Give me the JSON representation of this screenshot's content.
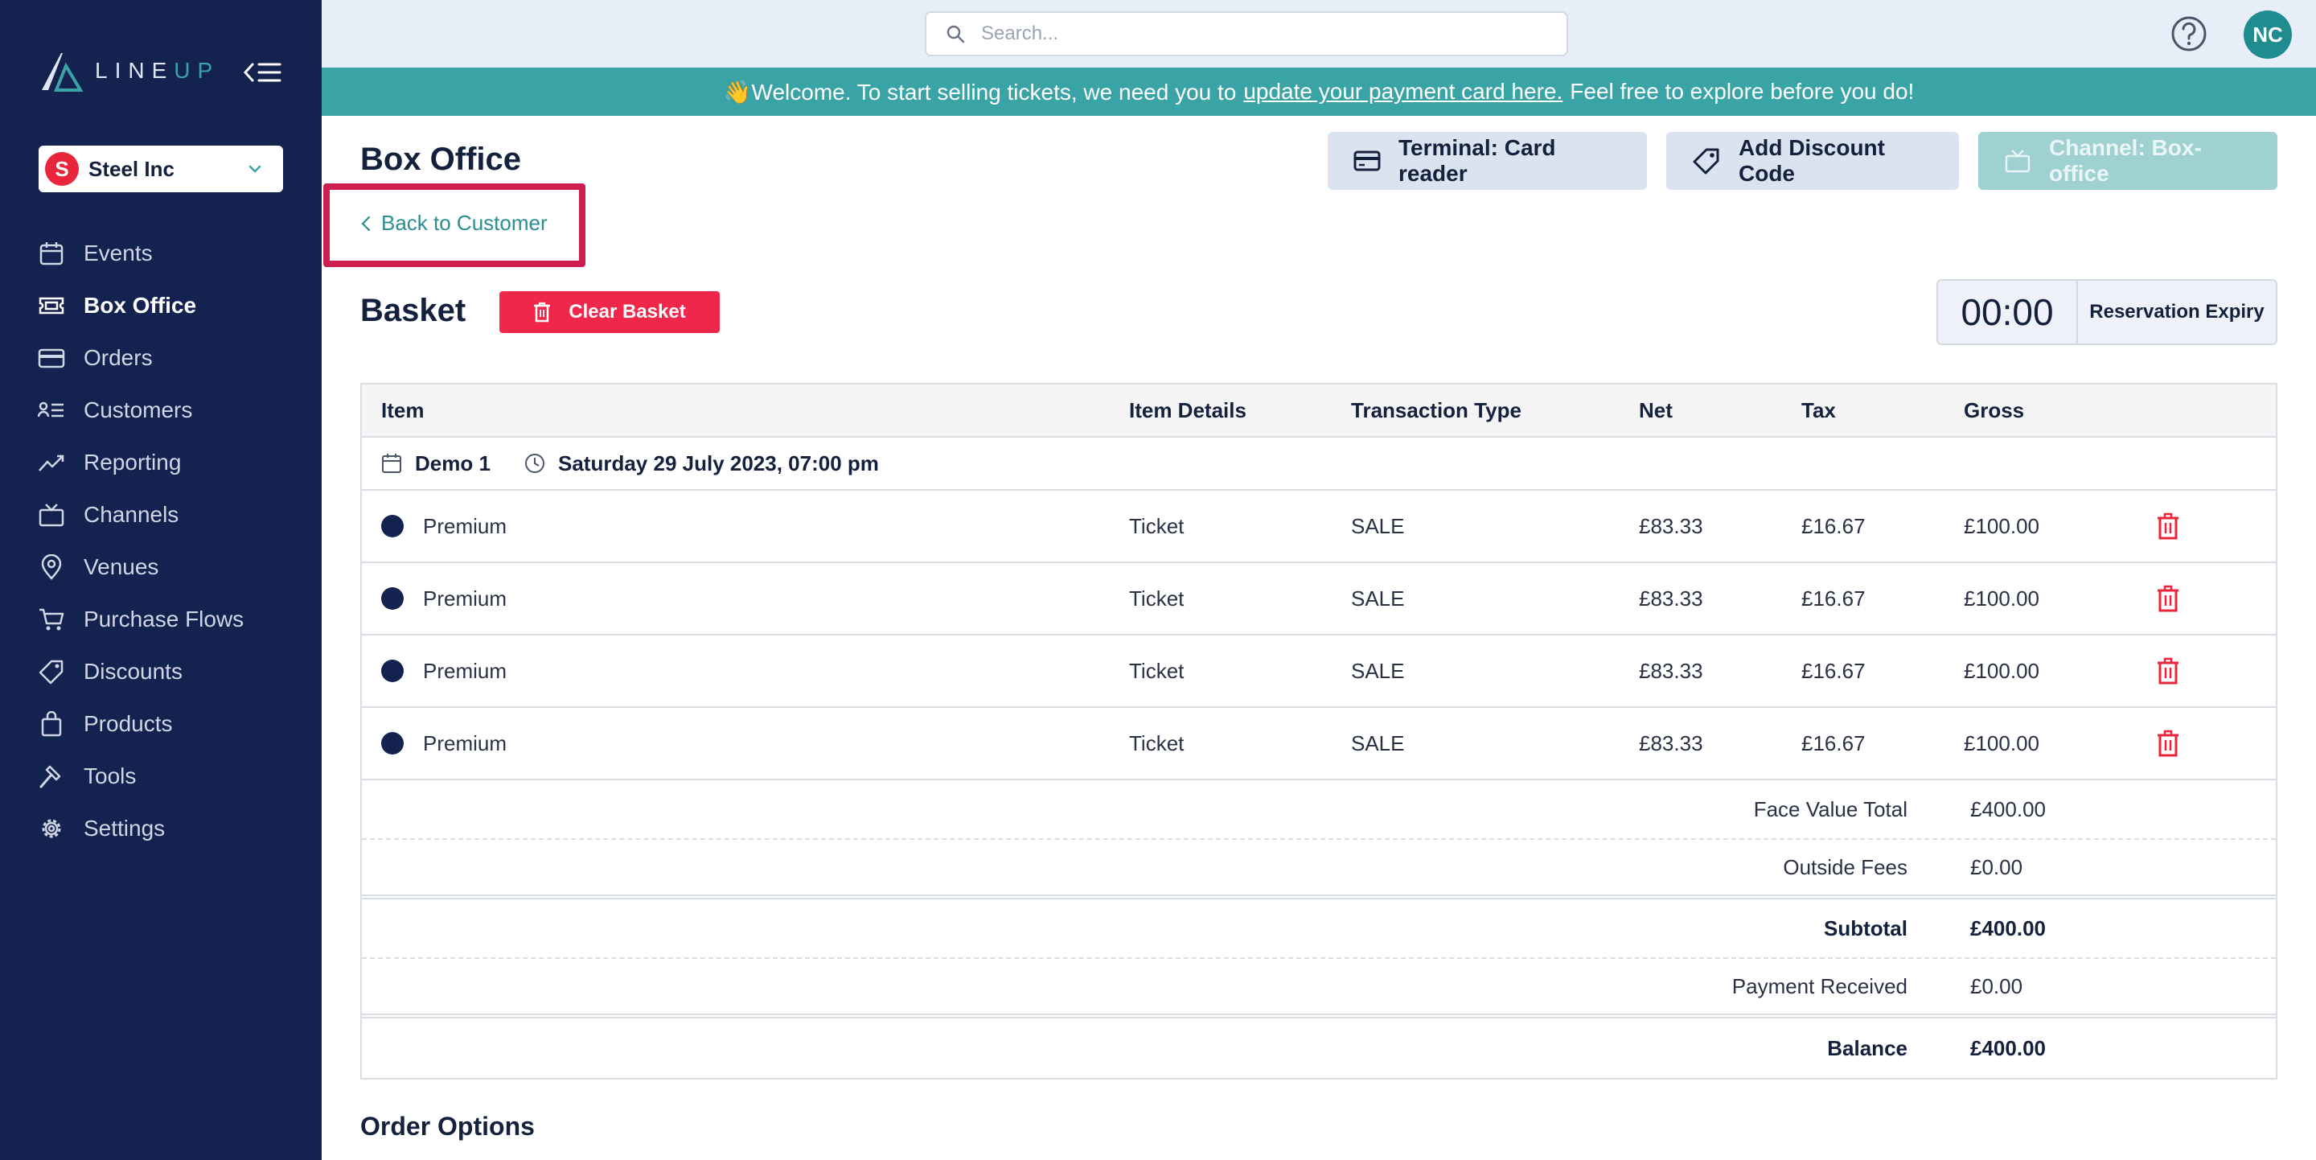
{
  "sidebar": {
    "logo": {
      "text_main": "LINE",
      "text_accent": "UP"
    },
    "org": {
      "badge": "S",
      "name": "Steel Inc"
    },
    "items": [
      {
        "label": "Events",
        "icon": "calendar-icon",
        "active": false
      },
      {
        "label": "Box Office",
        "icon": "ticket-icon",
        "active": true
      },
      {
        "label": "Orders",
        "icon": "credit-card-icon",
        "active": false
      },
      {
        "label": "Customers",
        "icon": "customers-list-icon",
        "active": false
      },
      {
        "label": "Reporting",
        "icon": "chart-line-icon",
        "active": false
      },
      {
        "label": "Channels",
        "icon": "tv-icon",
        "active": false
      },
      {
        "label": "Venues",
        "icon": "map-pin-icon",
        "active": false
      },
      {
        "label": "Purchase Flows",
        "icon": "cart-icon",
        "active": false
      },
      {
        "label": "Discounts",
        "icon": "tag-icon",
        "active": false
      },
      {
        "label": "Products",
        "icon": "bag-icon",
        "active": false
      },
      {
        "label": "Tools",
        "icon": "hammer-icon",
        "active": false
      },
      {
        "label": "Settings",
        "icon": "gear-icon",
        "active": false
      }
    ]
  },
  "topbar": {
    "search_placeholder": "Search...",
    "avatar_initials": "NC"
  },
  "banner": {
    "prefix": "👋Welcome. To start selling tickets, we need you to",
    "link": "update your payment card here.",
    "suffix": "Feel free to explore before you do!"
  },
  "header": {
    "title": "Box Office",
    "terminal_button": "Terminal: Card reader",
    "discount_button": "Add Discount Code",
    "channel_button": "Channel: Box-office",
    "back_link": "Back to Customer"
  },
  "basket": {
    "title": "Basket",
    "clear_button": "Clear Basket",
    "timer_value": "00:00",
    "timer_label": "Reservation Expiry",
    "columns": [
      "Item",
      "Item Details",
      "Transaction Type",
      "Net",
      "Tax",
      "Gross"
    ],
    "event": {
      "name": "Demo 1",
      "datetime": "Saturday 29 July 2023, 07:00 pm"
    },
    "rows": [
      {
        "item": "Premium",
        "details": "Ticket",
        "type": "SALE",
        "net": "£83.33",
        "tax": "£16.67",
        "gross": "£100.00"
      },
      {
        "item": "Premium",
        "details": "Ticket",
        "type": "SALE",
        "net": "£83.33",
        "tax": "£16.67",
        "gross": "£100.00"
      },
      {
        "item": "Premium",
        "details": "Ticket",
        "type": "SALE",
        "net": "£83.33",
        "tax": "£16.67",
        "gross": "£100.00"
      },
      {
        "item": "Premium",
        "details": "Ticket",
        "type": "SALE",
        "net": "£83.33",
        "tax": "£16.67",
        "gross": "£100.00"
      }
    ],
    "summary": [
      {
        "label": "Face Value Total",
        "value": "£400.00"
      },
      {
        "label": "Outside Fees",
        "value": "£0.00"
      },
      {
        "label": "Subtotal",
        "value": "£400.00"
      },
      {
        "label": "Payment Received",
        "value": "£0.00"
      },
      {
        "label": "Balance",
        "value": "£400.00"
      }
    ]
  },
  "order_options_title": "Order Options",
  "colors": {
    "sidebar": "#14224f",
    "accent": "#3aa3a6",
    "danger": "#f0274a",
    "highlight": "#cc1f4f"
  }
}
